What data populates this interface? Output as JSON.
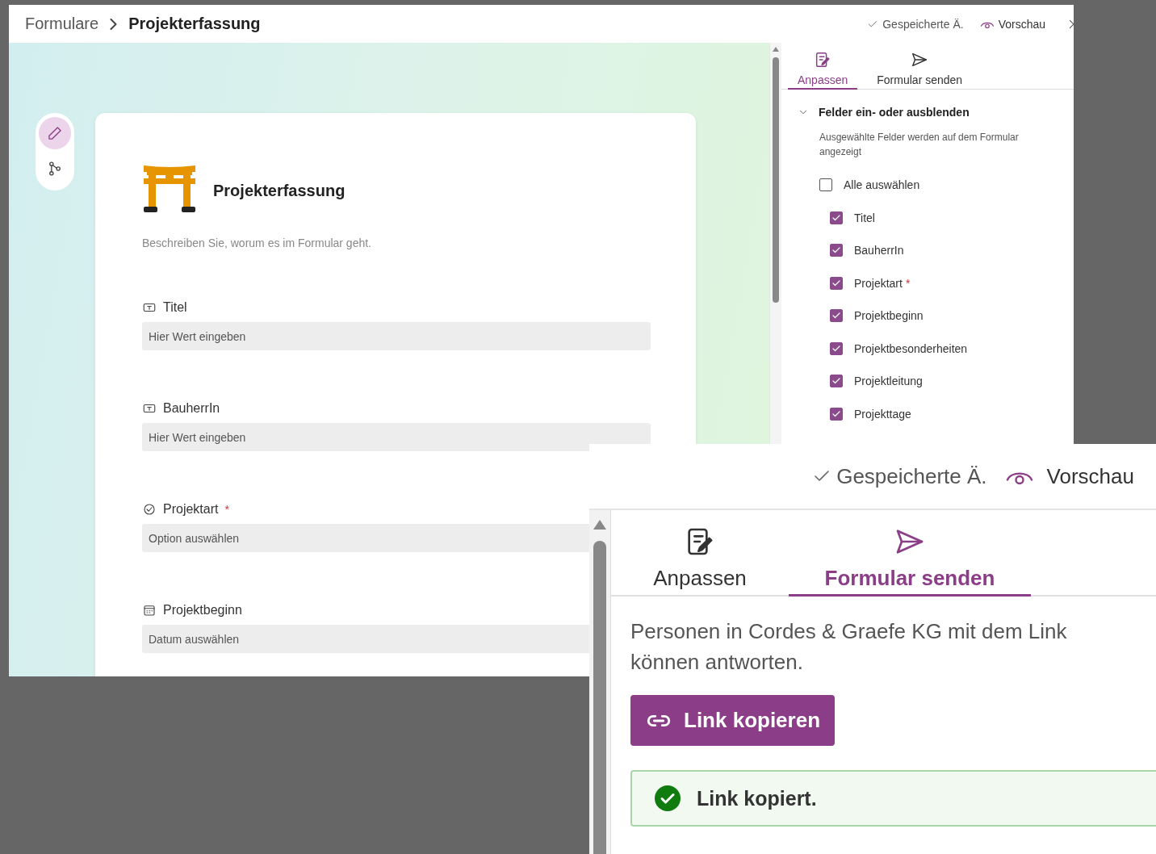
{
  "main_window": {
    "breadcrumb": [
      {
        "label": "Formulare"
      },
      {
        "label": "Projekterfassung"
      }
    ],
    "header": {
      "saved_status": "Gespeicherte Ä.",
      "preview": "Vorschau"
    },
    "side_toolbar": [
      {
        "kind": "edit",
        "selected": true
      },
      {
        "kind": "branching",
        "selected": false
      }
    ],
    "form": {
      "title": "Projekterfassung",
      "description": "Beschreiben Sie, worum es im Formular geht.",
      "fields": [
        {
          "kind": "text",
          "label": "Titel",
          "placeholder": "Hier Wert eingeben"
        },
        {
          "kind": "text",
          "label": "BauherrIn",
          "placeholder": "Hier Wert eingeben"
        },
        {
          "kind": "choice",
          "label": "Projektart",
          "required_mark": "*",
          "placeholder": "Option auswählen"
        },
        {
          "kind": "date",
          "label": "Projektbeginn",
          "placeholder": "Datum auswählen"
        }
      ]
    },
    "panel": {
      "tabs": [
        {
          "kind": "customize",
          "label": "Anpassen",
          "selected": true
        },
        {
          "kind": "send",
          "label": "Formular senden",
          "selected": false
        }
      ],
      "section": {
        "title": "Felder ein- oder ausblenden",
        "expanded": true,
        "hint": "Ausgewählte Felder werden auf dem Formular angezeigt",
        "select_all": {
          "label": "Alle auswählen",
          "checked": false
        },
        "fields": [
          {
            "label": "Titel",
            "checked": true
          },
          {
            "label": "BauherrIn",
            "checked": true
          },
          {
            "label": "Projektart",
            "required_mark": "*",
            "checked": true
          },
          {
            "label": "Projektbeginn",
            "checked": true
          },
          {
            "label": "Projektbesonderheiten",
            "checked": true
          },
          {
            "label": "Projektleitung",
            "checked": true
          },
          {
            "label": "Projekttage",
            "checked": true
          }
        ]
      }
    }
  },
  "zoom_window": {
    "header": {
      "saved_status": "Gespeicherte Ä.",
      "preview": "Vorschau"
    },
    "tabs": [
      {
        "kind": "customize",
        "label": "Anpassen",
        "selected": false
      },
      {
        "kind": "send",
        "label": "Formular senden",
        "selected": true
      }
    ],
    "share_text": "Personen in Cordes & Graefe KG mit dem Link können antworten.",
    "copy_button": "Link kopieren",
    "toast": "Link kopiert."
  }
}
